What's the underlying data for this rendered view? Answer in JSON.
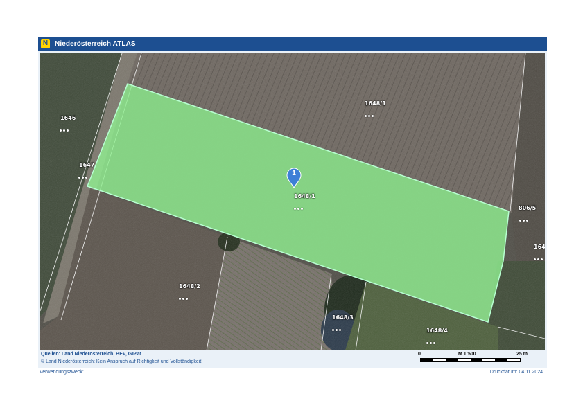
{
  "header": {
    "title": "Niederösterreich ATLAS",
    "logo_letter": "N"
  },
  "colors": {
    "header_bg": "#1d4f91",
    "logo": "#ffd200",
    "selection_fill": "#90ee90",
    "selection_stroke": "#b8ffd2",
    "marker": "#3d7fd6",
    "footer_text": "#1d4f91"
  },
  "map": {
    "view": "aerial orthophoto with cadastral parcel overlay",
    "selected_parcel": "1648/1",
    "marker_number": "1",
    "parcels": [
      {
        "number": "1648/1",
        "selected": true
      },
      {
        "number": "1646",
        "selected": false
      },
      {
        "number": "1647",
        "selected": false
      },
      {
        "number": "1648/1",
        "selected": false
      },
      {
        "number": "806/5",
        "selected": false
      },
      {
        "number": "1648/2",
        "selected": false
      },
      {
        "number": "1648/3",
        "selected": false
      },
      {
        "number": "1648/4",
        "selected": false
      },
      {
        "number": "164",
        "selected": false
      }
    ]
  },
  "footer": {
    "sources": "Quellen: Land Niederösterreich, BEV, GIP.at",
    "copyright": "© Land Niederösterreich: Kein Anspruch auf Richtigkeit und Vollständigkeit!",
    "scale_zero": "0",
    "scale_ratio": "M 1:500",
    "scale_end": "25 m"
  },
  "page_footer": {
    "usage": "Verwendungszweck:",
    "print_date": "Druckdatum: 04.11.2024"
  }
}
